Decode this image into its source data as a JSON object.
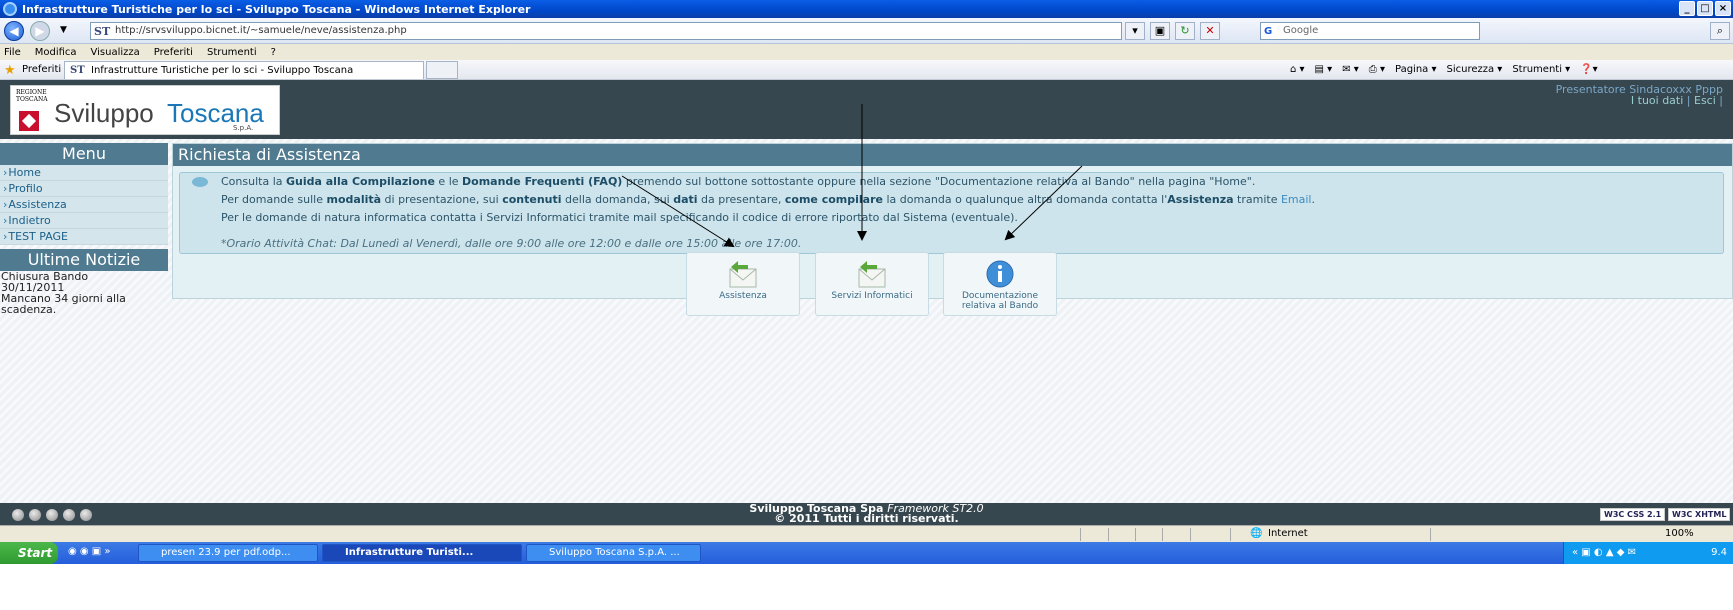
{
  "window": {
    "title": "Infrastrutture Turistiche per lo sci - Sviluppo Toscana - Windows Internet Explorer",
    "controls": [
      "_",
      "□",
      "×"
    ]
  },
  "address_bar": {
    "url": "http://srvsviluppo.bicnet.it/~samuele/neve/assistenza.php",
    "site_badge": "ST",
    "search_placeholder": "Google"
  },
  "menu": [
    "File",
    "Modifica",
    "Visualizza",
    "Preferiti",
    "Strumenti",
    "?"
  ],
  "favorites_bar": {
    "label": "Preferiti",
    "tab_title": "Infrastrutture Turistiche per lo sci - Sviluppo Toscana",
    "commands": [
      "Pagina ▾",
      "Sicurezza ▾",
      "Strumenti ▾"
    ]
  },
  "header": {
    "logo": {
      "region": "REGIONE\nTOSCANA",
      "name_part1": "Sviluppo",
      "name_part2": "Toscana",
      "suffix": "S.p.A."
    },
    "user": {
      "presenter": "Presentatore Sindacoxxx Pppp",
      "links": [
        "I tuoi dati",
        "Esci"
      ]
    }
  },
  "sidebar": {
    "menu_title": "Menu",
    "items": [
      {
        "label": "Home"
      },
      {
        "label": "Profilo"
      },
      {
        "label": "Assistenza"
      },
      {
        "label": "Indietro"
      },
      {
        "label": "TEST PAGE"
      }
    ],
    "news_title": "Ultime Notizie",
    "news_text": [
      "Chiusura Bando",
      "30/11/2011",
      "Mancano 34 giorni alla",
      "scadenza."
    ]
  },
  "main": {
    "title": "Richiesta di Assistenza",
    "line1": {
      "a": "Consulta la ",
      "b": "Guida alla Compilazione",
      "c": " e le ",
      "d": "Domande Frequenti (FAQ)",
      "e": " premendo sul bottone sottostante oppure nella sezione \"Documentazione relativa al Bando\" nella pagina \"Home\"."
    },
    "line2": {
      "a": "Per domande sulle ",
      "b": "modalità",
      "c": " di presentazione, sui ",
      "d": "contenuti",
      "e": " della domanda, sui ",
      "f": "dati",
      "g": " da presentare, ",
      "h": "come compilare",
      "i": " la domanda o qualunque altra domanda contatta l'",
      "j": "Assistenza",
      "k": " tramite ",
      "l": "Email",
      "m": "."
    },
    "line3": "Per le domande di natura informatica contatta i Servizi Informatici tramite mail specificando il codice di errore riportato dal Sistema (eventuale).",
    "line4": "*Orario Attività Chat: Dal Lunedì al Venerdì, dalle ore 9:00 alle ore 12:00 e dalle ore 15:00 alle ore 17:00.",
    "buttons": [
      {
        "label": "Assistenza",
        "icon": "envelope-reply-icon"
      },
      {
        "label": "Servizi Informatici",
        "icon": "envelope-reply-icon"
      },
      {
        "label": "Documentazione relativa al Bando",
        "icon": "info-icon"
      }
    ]
  },
  "footer": {
    "line1_bold": "Sviluppo Toscana Spa ",
    "line1_italic": "Framework ST2.0",
    "line2": "© 2011 Tutti i diritti riservati.",
    "badges": [
      "W3C CSS 2.1",
      "W3C XHTML"
    ]
  },
  "statusbar": {
    "zone": "Internet",
    "zoom": "100%"
  },
  "taskbar": {
    "start": "Start",
    "tasks": [
      "presen 23.9 per pdf.odp...",
      "Infrastrutture Turisti...",
      "Sviluppo Toscana S.p.A. ..."
    ],
    "clock": "9.4"
  }
}
